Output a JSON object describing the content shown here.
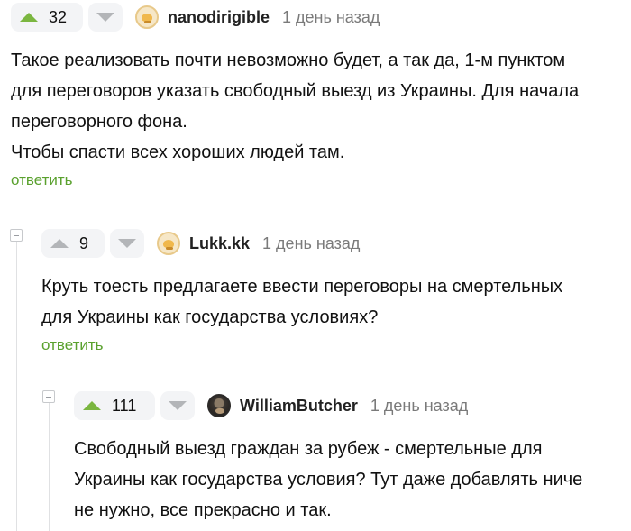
{
  "comments": [
    {
      "rating": "32",
      "username": "nanodirigible",
      "time": "1 день назад",
      "text": [
        "Такое реализовать почти невозможно будет, а так да, 1-м пунктом",
        "для переговоров указать свободный выезд из Украины. Для начала",
        "переговорного фона.",
        "Чтобы спасти всех хороших людей там."
      ],
      "reply_label": "ответить"
    },
    {
      "rating": "9",
      "username": "Lukk.kk",
      "time": "1 день назад",
      "text": [
        "Круть тоесть предлагаете ввести переговоры на смертельных",
        "для Украины как государства условиях?"
      ],
      "reply_label": "ответить"
    },
    {
      "rating": "111",
      "username": "WilliamButcher",
      "time": "1 день назад",
      "text": [
        "Свободный выезд граждан за рубеж - смертельные для",
        "Украины как государства условия? Тут даже добавлять ниче",
        "не нужно, все прекрасно и так."
      ]
    }
  ],
  "colors": {
    "accent": "#5aa12e",
    "upvote": "#7bb640",
    "muted": "#b3b5b8"
  }
}
